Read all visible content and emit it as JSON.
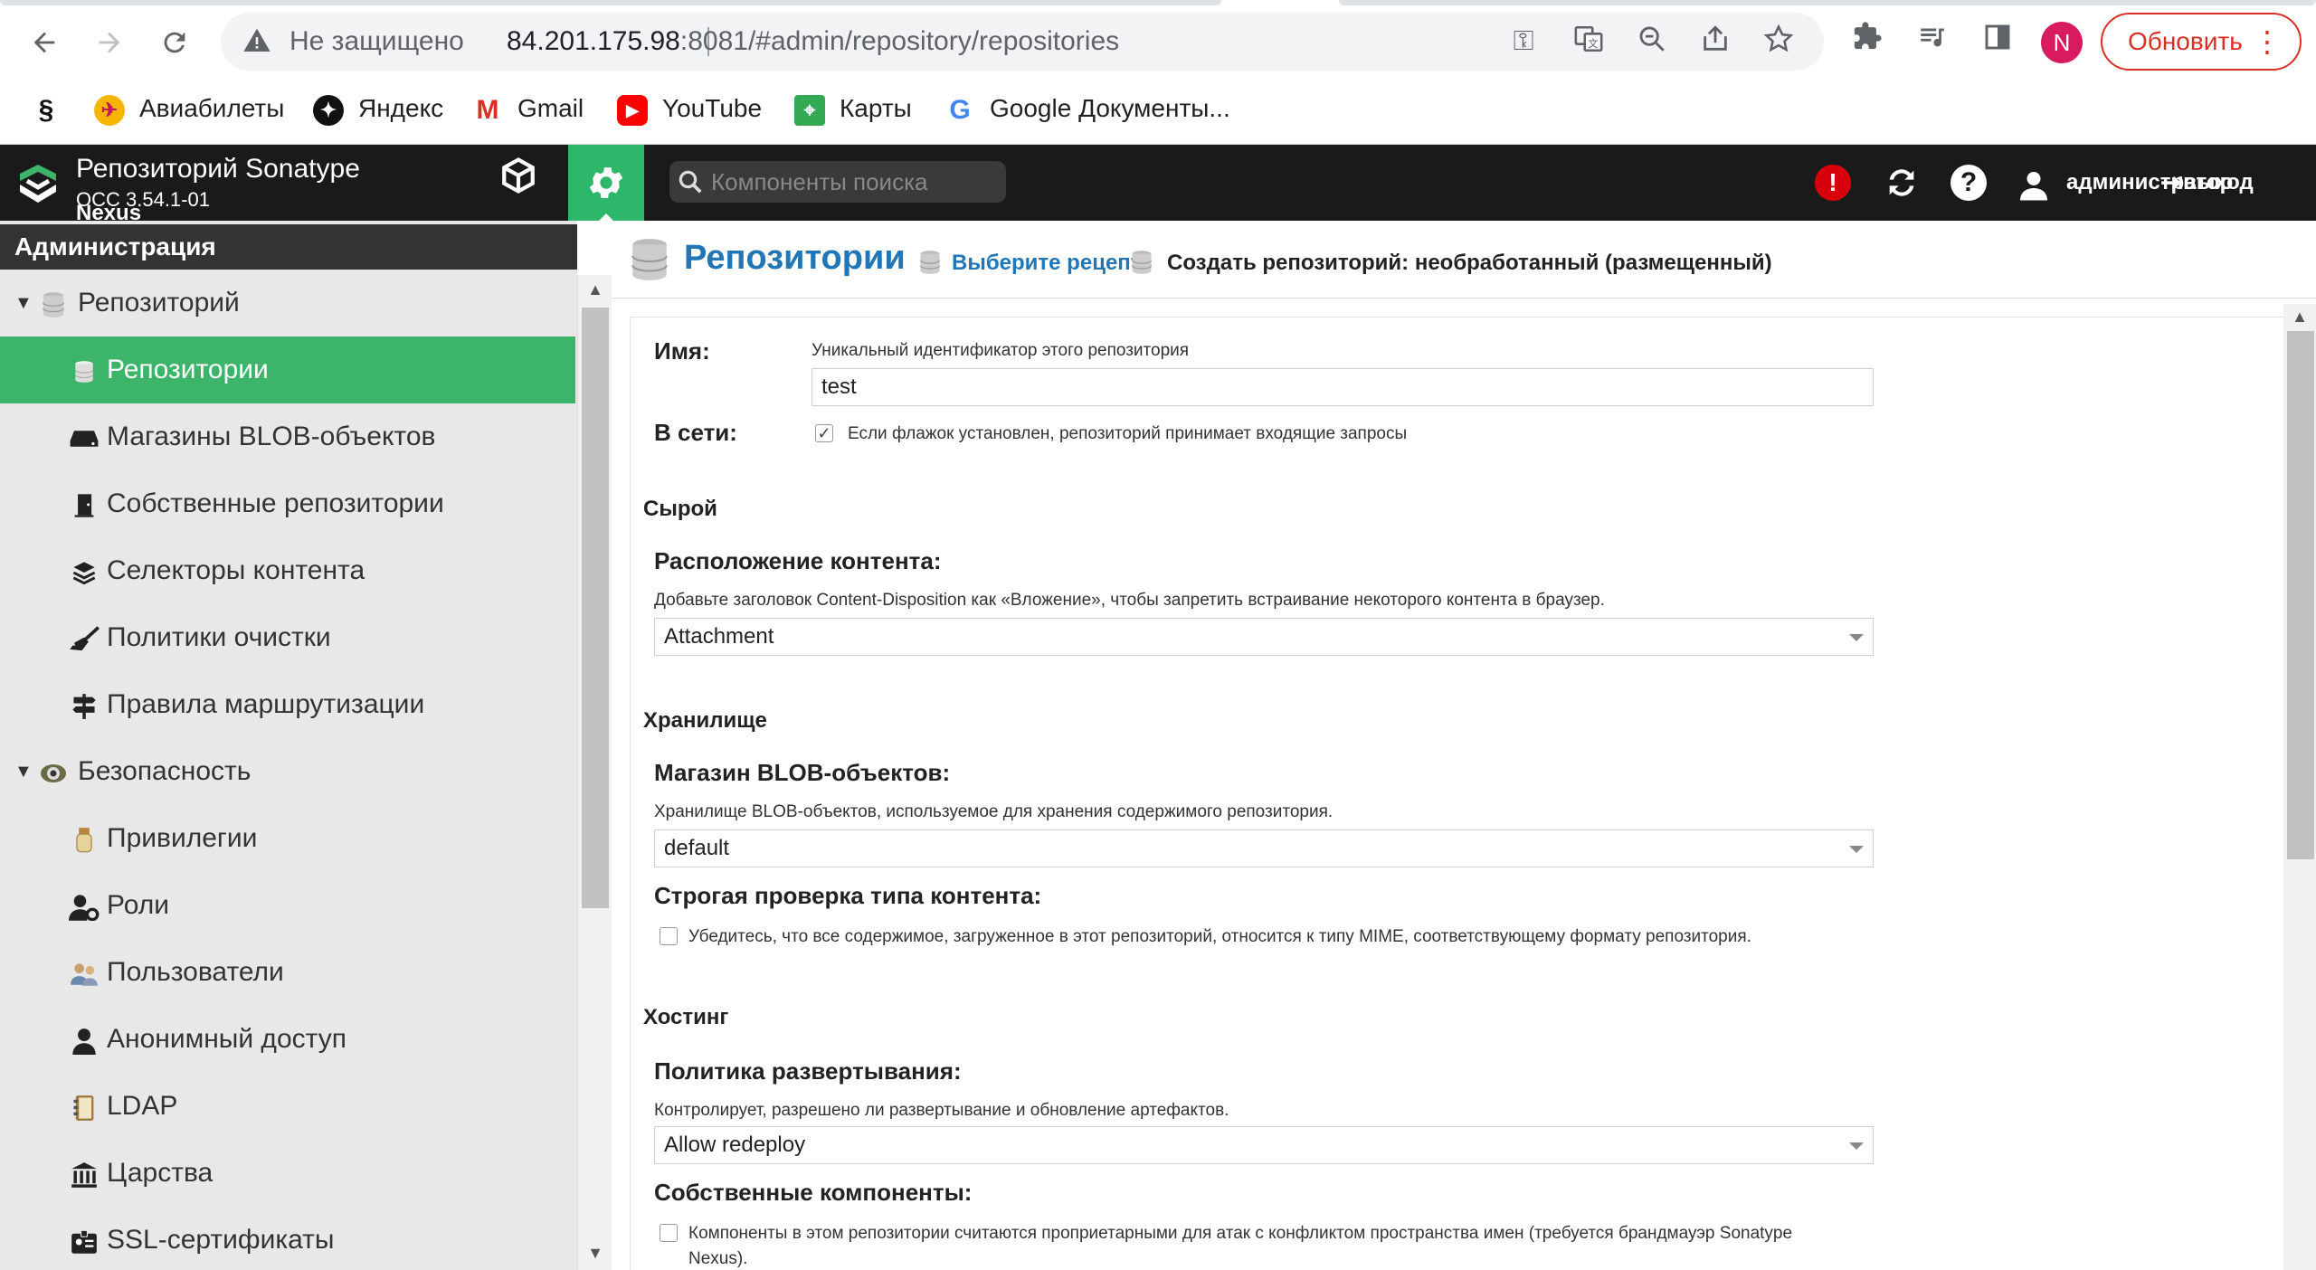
{
  "browser": {
    "security_label": "Не защищено",
    "url_host": "84.201.175.98",
    "url_port": ":8081",
    "url_path": "/#admin/repository/repositories",
    "profile_initial": "N",
    "update_label": "Обновить",
    "bookmarks": [
      {
        "label": "",
        "icon": "sberbank-icon"
      },
      {
        "label": "Авиабилеты",
        "icon": "aviatickets-icon"
      },
      {
        "label": "Яндекс",
        "icon": "yandex-icon"
      },
      {
        "label": "Gmail",
        "icon": "gmail-icon"
      },
      {
        "label": "YouTube",
        "icon": "youtube-icon"
      },
      {
        "label": "Карты",
        "icon": "maps-icon"
      },
      {
        "label": "Google Документы...",
        "icon": "google-icon"
      }
    ]
  },
  "app": {
    "title": "Репозиторий Sonatype",
    "version": "OCC 3.54.1-01",
    "title_overflow": "Nexus",
    "search_placeholder": "Компоненты поиска",
    "user": "администратор",
    "signout": "выход"
  },
  "sidebar": {
    "title": "Администрация",
    "groups": [
      {
        "label": "Репозиторий",
        "items": [
          {
            "label": "Репозитории",
            "active": true
          },
          {
            "label": "Магазины BLOB-объектов"
          },
          {
            "label": "Собственные репозитории"
          },
          {
            "label": "Селекторы контента"
          },
          {
            "label": "Политики очистки"
          },
          {
            "label": "Правила маршрутизации"
          }
        ]
      },
      {
        "label": "Безопасность",
        "items": [
          {
            "label": "Привилегии"
          },
          {
            "label": "Роли"
          },
          {
            "label": "Пользователи"
          },
          {
            "label": "Анонимный доступ"
          },
          {
            "label": "LDAP"
          },
          {
            "label": "Царства"
          },
          {
            "label": "SSL-сертификаты"
          }
        ]
      }
    ]
  },
  "content": {
    "title": "Репозитории",
    "breadcrumb_link": "Выберите рецепт",
    "breadcrumb_current": "Создать репозиторий: необработанный (размещенный)",
    "form": {
      "name_label": "Имя:",
      "name_help": "Уникальный идентификатор этого репозитория",
      "name_value": "test",
      "online_label": "В сети:",
      "online_help": "Если флажок установлен, репозиторий принимает входящие запросы",
      "section_raw": "Сырой",
      "disposition_label": "Расположение контента:",
      "disposition_help": "Добавьте заголовок Content-Disposition как «Вложение», чтобы запретить встраивание некоторого контента в браузер.",
      "disposition_value": "Attachment",
      "section_storage": "Хранилище",
      "blob_label": "Магазин BLOB-объектов:",
      "blob_help": "Хранилище BLOB-объектов, используемое для хранения содержимого репозитория.",
      "blob_value": "default",
      "strict_label": "Строгая проверка типа контента:",
      "strict_help": "Убедитесь, что все содержимое, загруженное в этот репозиторий, относится к типу MIME, соответствующему формату репозитория.",
      "section_hosting": "Хостинг",
      "deploy_label": "Политика развертывания:",
      "deploy_help": "Контролирует, разрешено ли развертывание и обновление артефактов.",
      "deploy_value": "Allow redeploy",
      "proprietary_label": "Собственные компоненты:",
      "proprietary_help_1": "Компоненты в этом репозитории считаются проприетарными для атак с конфликтом пространства имен (требуется брандмауэр Sonatype",
      "proprietary_help_2": "Nexus)."
    }
  },
  "colors": {
    "accent_green": "#3cb56a",
    "link_blue": "#2076b6",
    "header_dark": "#1a1a1a",
    "alert_red": "#d9000d"
  }
}
